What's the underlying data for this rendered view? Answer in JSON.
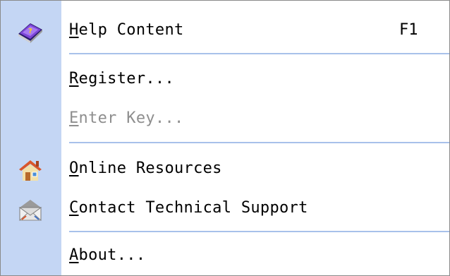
{
  "menu": {
    "items": [
      {
        "mnemonic": "H",
        "rest": "elp Content",
        "shortcut": "F1",
        "icon": "help-book-icon",
        "enabled": true
      },
      {
        "mnemonic": "R",
        "rest": "egister...",
        "shortcut": "",
        "icon": "",
        "enabled": true
      },
      {
        "mnemonic": "E",
        "rest": "nter Key...",
        "shortcut": "",
        "icon": "",
        "enabled": false
      },
      {
        "mnemonic": "O",
        "rest": "nline Resources",
        "shortcut": "",
        "icon": "home-icon",
        "enabled": true
      },
      {
        "mnemonic": "C",
        "rest": "ontact Technical Support",
        "shortcut": "",
        "icon": "envelope-icon",
        "enabled": true
      },
      {
        "mnemonic": "A",
        "rest": "bout...",
        "shortcut": "",
        "icon": "",
        "enabled": true
      }
    ]
  },
  "colors": {
    "gutter": "#c4d6f4",
    "separator": "#a8c1ea",
    "disabled_text": "#8e8e8e",
    "border": "#8a8a8a"
  }
}
